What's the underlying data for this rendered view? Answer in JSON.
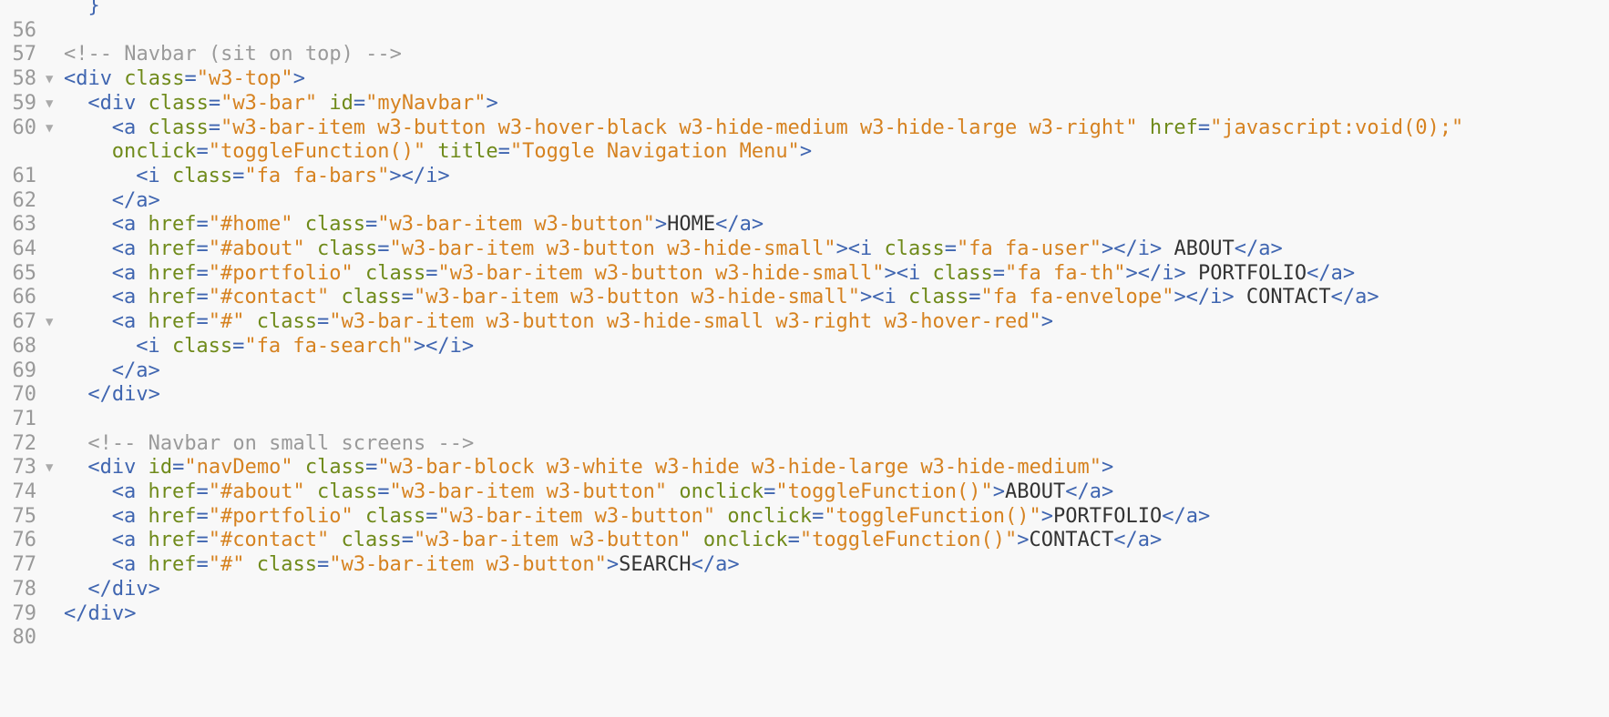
{
  "editor": {
    "lines": [
      {
        "n": "",
        "fold": false,
        "indent": 0,
        "tokens": [
          {
            "t": "tag",
            "v": "  }"
          }
        ]
      },
      {
        "n": "56",
        "fold": false,
        "indent": 0,
        "tokens": []
      },
      {
        "n": "57",
        "fold": false,
        "indent": 0,
        "tokens": [
          {
            "t": "comment",
            "v": "<!-- Navbar (sit on top) -->"
          }
        ]
      },
      {
        "n": "58",
        "fold": true,
        "indent": 0,
        "tokens": [
          {
            "t": "tag",
            "v": "<div "
          },
          {
            "t": "attr",
            "v": "class"
          },
          {
            "t": "punct",
            "v": "="
          },
          {
            "t": "val",
            "v": "\"w3-top\""
          },
          {
            "t": "tag",
            "v": ">"
          }
        ]
      },
      {
        "n": "59",
        "fold": true,
        "indent": 1,
        "tokens": [
          {
            "t": "tag",
            "v": "<div "
          },
          {
            "t": "attr",
            "v": "class"
          },
          {
            "t": "punct",
            "v": "="
          },
          {
            "t": "val",
            "v": "\"w3-bar\""
          },
          {
            "t": "attr",
            "v": " id"
          },
          {
            "t": "punct",
            "v": "="
          },
          {
            "t": "val",
            "v": "\"myNavbar\""
          },
          {
            "t": "tag",
            "v": ">"
          }
        ]
      },
      {
        "n": "60",
        "fold": true,
        "indent": 2,
        "tokens": [
          {
            "t": "tag",
            "v": "<a "
          },
          {
            "t": "attr",
            "v": "class"
          },
          {
            "t": "punct",
            "v": "="
          },
          {
            "t": "val",
            "v": "\"w3-bar-item w3-button w3-hover-black w3-hide-medium w3-hide-large w3-right\""
          },
          {
            "t": "attr",
            "v": " href"
          },
          {
            "t": "punct",
            "v": "="
          },
          {
            "t": "val",
            "v": "\"javascript:void(0);\""
          }
        ]
      },
      {
        "n": "",
        "fold": false,
        "indent": 2,
        "tokens": [
          {
            "t": "attr",
            "v": "onclick"
          },
          {
            "t": "punct",
            "v": "="
          },
          {
            "t": "val",
            "v": "\"toggleFunction()\""
          },
          {
            "t": "attr",
            "v": " title"
          },
          {
            "t": "punct",
            "v": "="
          },
          {
            "t": "val",
            "v": "\"Toggle Navigation Menu\""
          },
          {
            "t": "tag",
            "v": ">"
          }
        ]
      },
      {
        "n": "61",
        "fold": false,
        "indent": 3,
        "tokens": [
          {
            "t": "tag",
            "v": "<i "
          },
          {
            "t": "attr",
            "v": "class"
          },
          {
            "t": "punct",
            "v": "="
          },
          {
            "t": "val",
            "v": "\"fa fa-bars\""
          },
          {
            "t": "tag",
            "v": "></i>"
          }
        ]
      },
      {
        "n": "62",
        "fold": false,
        "indent": 2,
        "tokens": [
          {
            "t": "tag",
            "v": "</a>"
          }
        ]
      },
      {
        "n": "63",
        "fold": false,
        "indent": 2,
        "tokens": [
          {
            "t": "tag",
            "v": "<a "
          },
          {
            "t": "attr",
            "v": "href"
          },
          {
            "t": "punct",
            "v": "="
          },
          {
            "t": "val",
            "v": "\"#home\""
          },
          {
            "t": "attr",
            "v": " class"
          },
          {
            "t": "punct",
            "v": "="
          },
          {
            "t": "val",
            "v": "\"w3-bar-item w3-button\""
          },
          {
            "t": "tag",
            "v": ">"
          },
          {
            "t": "text",
            "v": "HOME"
          },
          {
            "t": "tag",
            "v": "</a>"
          }
        ]
      },
      {
        "n": "64",
        "fold": false,
        "indent": 2,
        "tokens": [
          {
            "t": "tag",
            "v": "<a "
          },
          {
            "t": "attr",
            "v": "href"
          },
          {
            "t": "punct",
            "v": "="
          },
          {
            "t": "val",
            "v": "\"#about\""
          },
          {
            "t": "attr",
            "v": " class"
          },
          {
            "t": "punct",
            "v": "="
          },
          {
            "t": "val",
            "v": "\"w3-bar-item w3-button w3-hide-small\""
          },
          {
            "t": "tag",
            "v": "><i "
          },
          {
            "t": "attr",
            "v": "class"
          },
          {
            "t": "punct",
            "v": "="
          },
          {
            "t": "val",
            "v": "\"fa fa-user\""
          },
          {
            "t": "tag",
            "v": "></i>"
          },
          {
            "t": "text",
            "v": " ABOUT"
          },
          {
            "t": "tag",
            "v": "</a>"
          }
        ]
      },
      {
        "n": "65",
        "fold": false,
        "indent": 2,
        "tokens": [
          {
            "t": "tag",
            "v": "<a "
          },
          {
            "t": "attr",
            "v": "href"
          },
          {
            "t": "punct",
            "v": "="
          },
          {
            "t": "val",
            "v": "\"#portfolio\""
          },
          {
            "t": "attr",
            "v": " class"
          },
          {
            "t": "punct",
            "v": "="
          },
          {
            "t": "val",
            "v": "\"w3-bar-item w3-button w3-hide-small\""
          },
          {
            "t": "tag",
            "v": "><i "
          },
          {
            "t": "attr",
            "v": "class"
          },
          {
            "t": "punct",
            "v": "="
          },
          {
            "t": "val",
            "v": "\"fa fa-th\""
          },
          {
            "t": "tag",
            "v": "></i>"
          },
          {
            "t": "text",
            "v": " PORTFOLIO"
          },
          {
            "t": "tag",
            "v": "</a>"
          }
        ]
      },
      {
        "n": "66",
        "fold": false,
        "indent": 2,
        "tokens": [
          {
            "t": "tag",
            "v": "<a "
          },
          {
            "t": "attr",
            "v": "href"
          },
          {
            "t": "punct",
            "v": "="
          },
          {
            "t": "val",
            "v": "\"#contact\""
          },
          {
            "t": "attr",
            "v": " class"
          },
          {
            "t": "punct",
            "v": "="
          },
          {
            "t": "val",
            "v": "\"w3-bar-item w3-button w3-hide-small\""
          },
          {
            "t": "tag",
            "v": "><i "
          },
          {
            "t": "attr",
            "v": "class"
          },
          {
            "t": "punct",
            "v": "="
          },
          {
            "t": "val",
            "v": "\"fa fa-envelope\""
          },
          {
            "t": "tag",
            "v": "></i>"
          },
          {
            "t": "text",
            "v": " CONTACT"
          },
          {
            "t": "tag",
            "v": "</a>"
          }
        ]
      },
      {
        "n": "67",
        "fold": true,
        "indent": 2,
        "tokens": [
          {
            "t": "tag",
            "v": "<a "
          },
          {
            "t": "attr",
            "v": "href"
          },
          {
            "t": "punct",
            "v": "="
          },
          {
            "t": "val",
            "v": "\"#\""
          },
          {
            "t": "attr",
            "v": " class"
          },
          {
            "t": "punct",
            "v": "="
          },
          {
            "t": "val",
            "v": "\"w3-bar-item w3-button w3-hide-small w3-right w3-hover-red\""
          },
          {
            "t": "tag",
            "v": ">"
          }
        ]
      },
      {
        "n": "68",
        "fold": false,
        "indent": 3,
        "tokens": [
          {
            "t": "tag",
            "v": "<i "
          },
          {
            "t": "attr",
            "v": "class"
          },
          {
            "t": "punct",
            "v": "="
          },
          {
            "t": "val",
            "v": "\"fa fa-search\""
          },
          {
            "t": "tag",
            "v": "></i>"
          }
        ]
      },
      {
        "n": "69",
        "fold": false,
        "indent": 2,
        "tokens": [
          {
            "t": "tag",
            "v": "</a>"
          }
        ]
      },
      {
        "n": "70",
        "fold": false,
        "indent": 1,
        "tokens": [
          {
            "t": "tag",
            "v": "</div>"
          }
        ]
      },
      {
        "n": "71",
        "fold": false,
        "indent": 0,
        "tokens": []
      },
      {
        "n": "72",
        "fold": false,
        "indent": 1,
        "tokens": [
          {
            "t": "comment",
            "v": "<!-- Navbar on small screens -->"
          }
        ]
      },
      {
        "n": "73",
        "fold": true,
        "indent": 1,
        "tokens": [
          {
            "t": "tag",
            "v": "<div "
          },
          {
            "t": "attr",
            "v": "id"
          },
          {
            "t": "punct",
            "v": "="
          },
          {
            "t": "val",
            "v": "\"navDemo\""
          },
          {
            "t": "attr",
            "v": " class"
          },
          {
            "t": "punct",
            "v": "="
          },
          {
            "t": "val",
            "v": "\"w3-bar-block w3-white w3-hide w3-hide-large w3-hide-medium\""
          },
          {
            "t": "tag",
            "v": ">"
          }
        ]
      },
      {
        "n": "74",
        "fold": false,
        "indent": 2,
        "tokens": [
          {
            "t": "tag",
            "v": "<a "
          },
          {
            "t": "attr",
            "v": "href"
          },
          {
            "t": "punct",
            "v": "="
          },
          {
            "t": "val",
            "v": "\"#about\""
          },
          {
            "t": "attr",
            "v": " class"
          },
          {
            "t": "punct",
            "v": "="
          },
          {
            "t": "val",
            "v": "\"w3-bar-item w3-button\""
          },
          {
            "t": "attr",
            "v": " onclick"
          },
          {
            "t": "punct",
            "v": "="
          },
          {
            "t": "val",
            "v": "\"toggleFunction()\""
          },
          {
            "t": "tag",
            "v": ">"
          },
          {
            "t": "text",
            "v": "ABOUT"
          },
          {
            "t": "tag",
            "v": "</a>"
          }
        ]
      },
      {
        "n": "75",
        "fold": false,
        "indent": 2,
        "tokens": [
          {
            "t": "tag",
            "v": "<a "
          },
          {
            "t": "attr",
            "v": "href"
          },
          {
            "t": "punct",
            "v": "="
          },
          {
            "t": "val",
            "v": "\"#portfolio\""
          },
          {
            "t": "attr",
            "v": " class"
          },
          {
            "t": "punct",
            "v": "="
          },
          {
            "t": "val",
            "v": "\"w3-bar-item w3-button\""
          },
          {
            "t": "attr",
            "v": " onclick"
          },
          {
            "t": "punct",
            "v": "="
          },
          {
            "t": "val",
            "v": "\"toggleFunction()\""
          },
          {
            "t": "tag",
            "v": ">"
          },
          {
            "t": "text",
            "v": "PORTFOLIO"
          },
          {
            "t": "tag",
            "v": "</a>"
          }
        ]
      },
      {
        "n": "76",
        "fold": false,
        "indent": 2,
        "tokens": [
          {
            "t": "tag",
            "v": "<a "
          },
          {
            "t": "attr",
            "v": "href"
          },
          {
            "t": "punct",
            "v": "="
          },
          {
            "t": "val",
            "v": "\"#contact\""
          },
          {
            "t": "attr",
            "v": " class"
          },
          {
            "t": "punct",
            "v": "="
          },
          {
            "t": "val",
            "v": "\"w3-bar-item w3-button\""
          },
          {
            "t": "attr",
            "v": " onclick"
          },
          {
            "t": "punct",
            "v": "="
          },
          {
            "t": "val",
            "v": "\"toggleFunction()\""
          },
          {
            "t": "tag",
            "v": ">"
          },
          {
            "t": "text",
            "v": "CONTACT"
          },
          {
            "t": "tag",
            "v": "</a>"
          }
        ]
      },
      {
        "n": "77",
        "fold": false,
        "indent": 2,
        "tokens": [
          {
            "t": "tag",
            "v": "<a "
          },
          {
            "t": "attr",
            "v": "href"
          },
          {
            "t": "punct",
            "v": "="
          },
          {
            "t": "val",
            "v": "\"#\""
          },
          {
            "t": "attr",
            "v": " class"
          },
          {
            "t": "punct",
            "v": "="
          },
          {
            "t": "val",
            "v": "\"w3-bar-item w3-button\""
          },
          {
            "t": "tag",
            "v": ">"
          },
          {
            "t": "text",
            "v": "SEARCH"
          },
          {
            "t": "tag",
            "v": "</a>"
          }
        ]
      },
      {
        "n": "78",
        "fold": false,
        "indent": 1,
        "tokens": [
          {
            "t": "tag",
            "v": "</div>"
          }
        ]
      },
      {
        "n": "79",
        "fold": false,
        "indent": 0,
        "tokens": [
          {
            "t": "tag",
            "v": "</div>"
          }
        ]
      },
      {
        "n": "80",
        "fold": false,
        "indent": 0,
        "tokens": []
      }
    ],
    "fold_icon": "fold-arrow-icon"
  }
}
